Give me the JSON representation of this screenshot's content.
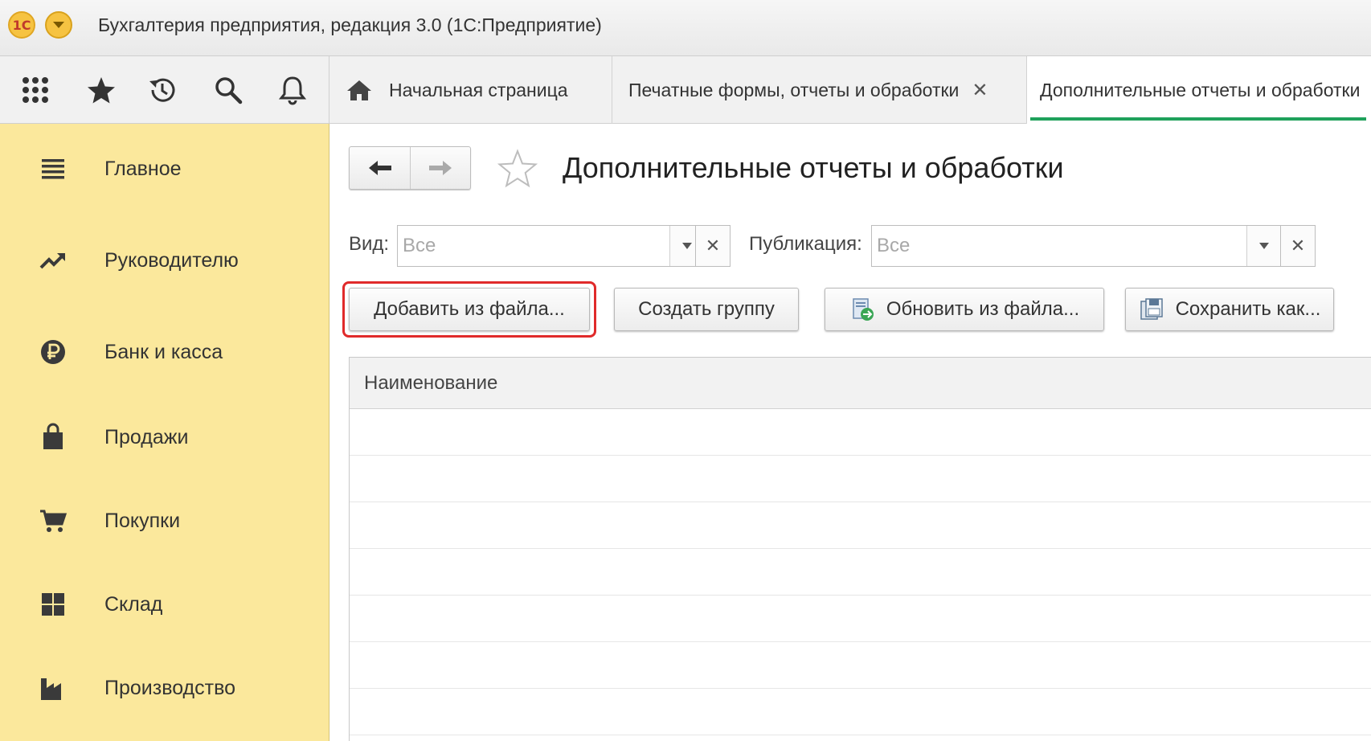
{
  "window": {
    "logo_text": "1С",
    "title": "Бухгалтерия предприятия, редакция 3.0  (1С:Предприятие)"
  },
  "toolbar": {
    "icons": [
      "apps-grid-icon",
      "star-icon",
      "history-icon",
      "search-icon",
      "bell-icon"
    ]
  },
  "tabs": [
    {
      "label": "Начальная страница",
      "icon": "home-icon"
    },
    {
      "label": "Печатные формы, отчеты и обработки",
      "closable": true,
      "close_glyph": "✕"
    },
    {
      "label": "Дополнительные отчеты и обработки",
      "active": true
    }
  ],
  "sidebar": {
    "items": [
      {
        "label": "Главное",
        "icon": "menu-lines-icon"
      },
      {
        "label": "Руководителю",
        "icon": "trend-up-icon"
      },
      {
        "label": "Банк и касса",
        "icon": "ruble-coin-icon"
      },
      {
        "label": "Продажи",
        "icon": "shopping-bag-icon"
      },
      {
        "label": "Покупки",
        "icon": "cart-icon"
      },
      {
        "label": "Склад",
        "icon": "warehouse-grid-icon"
      },
      {
        "label": "Производство",
        "icon": "factory-icon"
      }
    ],
    "background": "#fbe89c"
  },
  "main": {
    "title": "Дополнительные отчеты и обработки",
    "filters": {
      "kind": {
        "label": "Вид:",
        "placeholder": "Все",
        "clear_glyph": "✕"
      },
      "publication": {
        "label": "Публикация:",
        "placeholder": "Все",
        "clear_glyph": "✕"
      }
    },
    "buttons": {
      "add_from_file": "Добавить из файла...",
      "create_group": "Создать группу",
      "update_from_file": "Обновить из файла...",
      "save_as": "Сохранить как..."
    },
    "table": {
      "columns": [
        "Наименование"
      ],
      "rows": []
    }
  },
  "colors": {
    "accent_green": "#1fa15b",
    "highlight_red": "#e02a2a",
    "logo_yellow": "#f6c342"
  }
}
